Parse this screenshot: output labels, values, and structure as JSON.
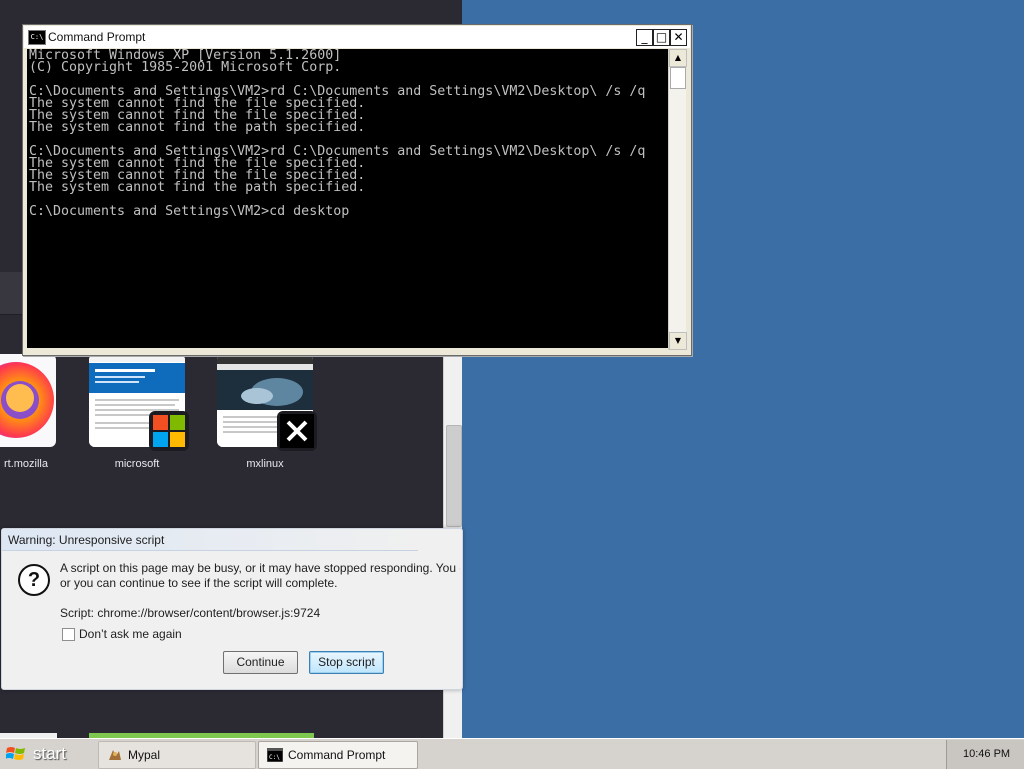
{
  "cmd_window": {
    "title": "Command Prompt",
    "title_icon": "C:\\",
    "minimize": "_",
    "maximize": "□",
    "close": "✕",
    "console_lines": [
      "Microsoft Windows XP [Version 5.1.2600]",
      "(C) Copyright 1985-2001 Microsoft Corp.",
      "",
      "C:\\Documents and Settings\\VM2>rd C:\\Documents and Settings\\VM2\\Desktop\\ /s /q",
      "The system cannot find the file specified.",
      "The system cannot find the file specified.",
      "The system cannot find the path specified.",
      "",
      "C:\\Documents and Settings\\VM2>rd C:\\Documents and Settings\\VM2\\Desktop\\ /s /q",
      "The system cannot find the file specified.",
      "The system cannot find the file specified.",
      "The system cannot find the path specified.",
      "",
      "C:\\Documents and Settings\\VM2>cd desktop"
    ]
  },
  "browser": {
    "top_sites": [
      {
        "label": "rt.mozilla"
      },
      {
        "label": "microsoft"
      },
      {
        "label": "mxlinux"
      }
    ]
  },
  "warning_dialog": {
    "title": "Warning: Unresponsive script",
    "message_line1": "A script on this page may be busy, or it may have stopped responding. You c",
    "message_line2": "or you can continue to see if the script will complete.",
    "script_line": "Script: chrome://browser/content/browser.js:9724",
    "checkbox_label": "Don’t ask me again",
    "continue_label": "Continue",
    "stop_label": "Stop script",
    "question_glyph": "?"
  },
  "taskbar": {
    "start_label": "start",
    "tasks": [
      {
        "label": "Mypal"
      },
      {
        "label": "Command Prompt"
      }
    ],
    "clock": "10:46 PM"
  }
}
